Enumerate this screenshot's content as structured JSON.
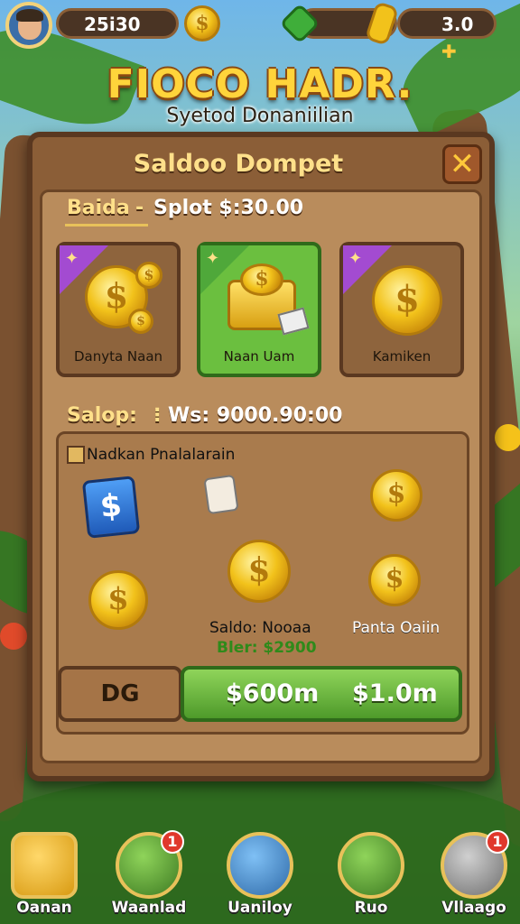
{
  "topbar": {
    "currency_amount": "25i30",
    "energy_amount": "3.0"
  },
  "header": {
    "title": "FIOCO HADR.",
    "subtitle": "Syetod Donaniilian"
  },
  "panel": {
    "title": "Saldoo Dompet",
    "close_symbol": "✕",
    "balance_label": "Baida",
    "balance_value": "Splot $:30.00",
    "cards": [
      {
        "label": "Danyta Naan",
        "tag": "purple"
      },
      {
        "label": "Naan Uam",
        "tag": "green"
      },
      {
        "label": "Kamiken",
        "tag": "purple"
      }
    ],
    "section_label": "Salop:",
    "section_value": "Ws: 9000.90:00",
    "checkbox_label": "Nadkan Pnalalarain",
    "items": [
      {
        "label": "Saldo: Nooaa",
        "sublabel": "Bler: $2900"
      },
      {
        "label": "Panta Oaiin"
      }
    ],
    "buttons": {
      "dg": "DG",
      "buy_left": "$600m",
      "buy_right": "$1.0m"
    }
  },
  "nav": [
    {
      "label": "Oanan",
      "badge": ""
    },
    {
      "label": "Waanlad",
      "badge": "1"
    },
    {
      "label": "Uaniloy",
      "badge": ""
    },
    {
      "label": "Ruo",
      "badge": ""
    },
    {
      "label": "Vllaago",
      "badge": "1"
    }
  ],
  "colors": {
    "panel_brown": "#8b5e37",
    "title_gold": "#ffd43b",
    "buy_green": "#4e9a2a",
    "badge_red": "#e0382c"
  }
}
